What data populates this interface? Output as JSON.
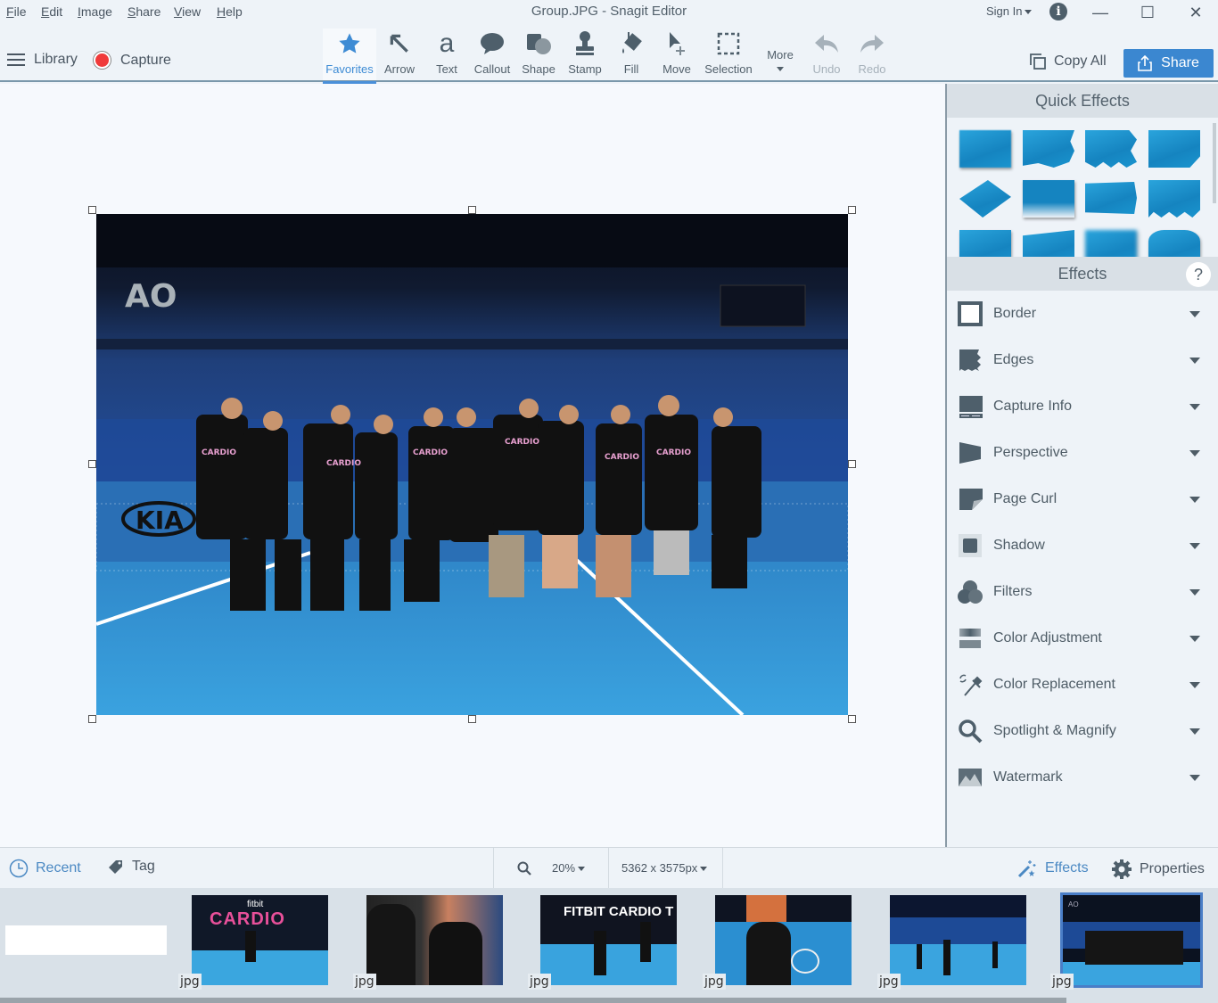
{
  "window": {
    "title": "Group.JPG - Snagit Editor",
    "sign_in": "Sign In",
    "info_icon": "i",
    "minimize": "—",
    "maximize": "☐",
    "close": "✕"
  },
  "menu": [
    "File",
    "Edit",
    "Image",
    "Share",
    "View",
    "Help"
  ],
  "toolbar": {
    "library": "Library",
    "capture": "Capture",
    "tools": [
      {
        "label": "Favorites",
        "icon": "star-icon",
        "active": true
      },
      {
        "label": "Arrow",
        "icon": "arrow-icon"
      },
      {
        "label": "Text",
        "icon": "text-icon"
      },
      {
        "label": "Callout",
        "icon": "callout-icon"
      },
      {
        "label": "Shape",
        "icon": "shape-icon"
      },
      {
        "label": "Stamp",
        "icon": "stamp-icon"
      },
      {
        "label": "Fill",
        "icon": "fill-icon"
      },
      {
        "label": "Move",
        "icon": "move-icon"
      },
      {
        "label": "Selection",
        "icon": "selection-icon"
      },
      {
        "label": "More",
        "icon": "more-icon"
      },
      {
        "label": "Undo",
        "icon": "undo-icon",
        "disabled": true
      },
      {
        "label": "Redo",
        "icon": "redo-icon",
        "disabled": true
      }
    ],
    "copy_all": "Copy All",
    "share": "Share"
  },
  "canvas": {
    "image_name": "Group.JPG",
    "image_description": "Group photo of people in black Fitbit Cardio t-shirts holding tennis rackets on a blue tennis court in a stadium",
    "photo_text": "AO"
  },
  "right_panel": {
    "quick_effects_title": "Quick Effects",
    "effects_title": "Effects",
    "help": "?",
    "effects": [
      {
        "label": "Border",
        "icon": "border-icon"
      },
      {
        "label": "Edges",
        "icon": "edges-icon"
      },
      {
        "label": "Capture Info",
        "icon": "capture-info-icon"
      },
      {
        "label": "Perspective",
        "icon": "perspective-icon"
      },
      {
        "label": "Page Curl",
        "icon": "page-curl-icon"
      },
      {
        "label": "Shadow",
        "icon": "shadow-icon"
      },
      {
        "label": "Filters",
        "icon": "filters-icon"
      },
      {
        "label": "Color Adjustment",
        "icon": "color-adjustment-icon"
      },
      {
        "label": "Color Replacement",
        "icon": "color-replacement-icon"
      },
      {
        "label": "Spotlight & Magnify",
        "icon": "spotlight-magnify-icon"
      },
      {
        "label": "Watermark",
        "icon": "watermark-icon"
      }
    ]
  },
  "bottom_bar": {
    "recent": "Recent",
    "tag": "Tag",
    "zoom": "20%",
    "dimensions": "5362 x 3575px",
    "effects": "Effects",
    "properties": "Properties"
  },
  "tray": {
    "search_value": "",
    "thumbnails": [
      {
        "type": "jpg",
        "text": "fitbit CARDIO"
      },
      {
        "type": "jpg"
      },
      {
        "type": "jpg",
        "text": "FITBIT CARDIO T"
      },
      {
        "type": "jpg"
      },
      {
        "type": "jpg"
      },
      {
        "type": "jpg",
        "selected": true,
        "text": "AO"
      }
    ]
  },
  "colors": {
    "accent": "#3b87d0",
    "capture_red": "#f03a3a",
    "effect_blue": "#1a95cf"
  }
}
